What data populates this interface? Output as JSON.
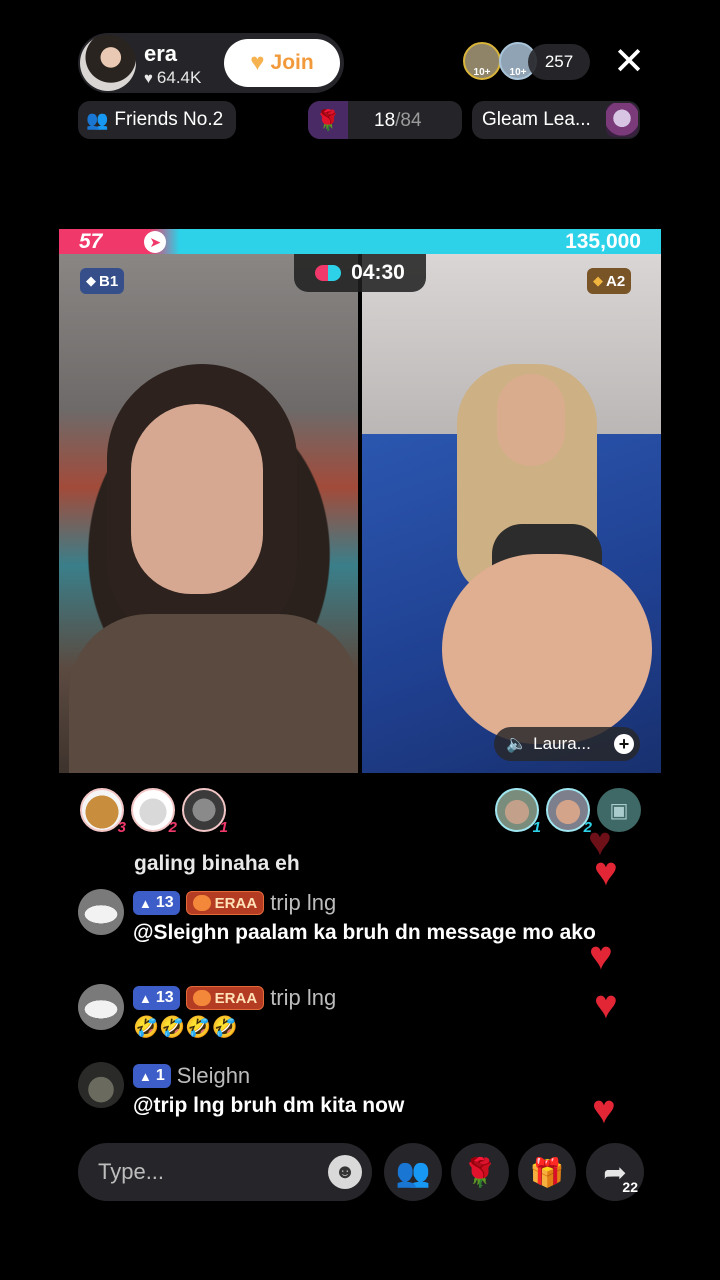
{
  "host": {
    "name": "era",
    "likes": "64.4K",
    "join_label": "Join"
  },
  "viewers": {
    "badges": [
      "10+",
      "10+"
    ],
    "count": "257"
  },
  "ranking": {
    "friends_label": "Friends No.2",
    "rose_progress": "18",
    "rose_goal": "/84",
    "league_label": "Gleam Lea..."
  },
  "battle": {
    "left_score": "57",
    "right_score": "135,000",
    "timer": "04:30",
    "left_tag": "B1",
    "right_tag": "A2",
    "left_share": 0.15,
    "colors": {
      "left": "#f0386a",
      "right": "#2ed2e8"
    }
  },
  "opponent": {
    "name": "Laura..."
  },
  "supporters": {
    "left": [
      {
        "rank": "3"
      },
      {
        "rank": "2"
      },
      {
        "rank": "1"
      }
    ],
    "right": [
      {
        "rank": "1"
      },
      {
        "rank": "2"
      }
    ]
  },
  "chat": {
    "fragment": "galing binaha eh",
    "messages": [
      {
        "level": "13",
        "fan_badge": "ERAA",
        "user": "trip lng",
        "text": "@Sleighn paalam ka  bruh dn message mo ako"
      },
      {
        "level": "13",
        "fan_badge": "ERAA",
        "user": "trip lng",
        "text": "🤣🤣🤣🤣"
      },
      {
        "level": "1",
        "user": "Sleighn",
        "text": "@trip lng bruh dm kita now"
      }
    ]
  },
  "composer": {
    "placeholder": "Type...",
    "share_count": "22"
  },
  "icons": {
    "heart": "♥",
    "close": "✕",
    "rose": "🌹",
    "gift": "🎁",
    "people": "👥",
    "share": "➦",
    "emoji": "☻",
    "muted": "🔇"
  }
}
